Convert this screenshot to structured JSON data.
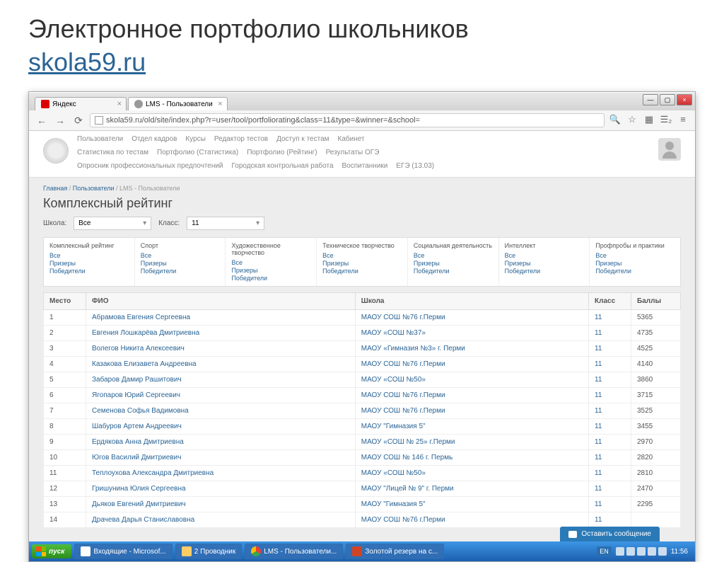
{
  "slide": {
    "title": "Электронное портфолио школьников",
    "link": "skola59.ru"
  },
  "browser": {
    "tabs": [
      {
        "title": "Яндекс"
      },
      {
        "title": "LMS - Пользователи"
      }
    ],
    "url": "skola59.ru/old/site/index.php?r=user/tool/portfoliorating&class=11&type=&winner=&school="
  },
  "nav": {
    "row1": [
      "Пользователи",
      "Отдел кадров",
      "Курсы",
      "Редактор тестов",
      "Доступ к тестам",
      "Кабинет"
    ],
    "row2": [
      "Статистика по тестам",
      "Портфолио (Статистика)",
      "Портфолио (Рейтинг)",
      "Результаты ОГЭ"
    ],
    "row3": [
      "Опросник профессиональных предпочтений",
      "Городская контрольная работа",
      "Воспитанники",
      "ЕГЭ (13.03)"
    ]
  },
  "breadcrumb": {
    "home": "Главная",
    "users": "Пользователи",
    "current": "LMS - Пользователи"
  },
  "pageTitle": "Комплексный рейтинг",
  "filters": {
    "schoolLabel": "Школа:",
    "schoolValue": "Все",
    "classLabel": "Класс:",
    "classValue": "11"
  },
  "categories": [
    "Комплексный рейтинг",
    "Спорт",
    "Художественное творчество",
    "Техническое творчество",
    "Социальная деятельность",
    "Интеллект",
    "Профпробы и практики"
  ],
  "catLinks": [
    "Все",
    "Призеры",
    "Победители"
  ],
  "tableHeaders": {
    "place": "Место",
    "name": "ФИО",
    "school": "Школа",
    "class": "Класс",
    "points": "Баллы"
  },
  "rows": [
    {
      "n": "1",
      "name": "Абрамова Евгения Сергеевна",
      "school": "МАОУ СОШ №76 г.Перми",
      "cls": "11",
      "pts": "5365"
    },
    {
      "n": "2",
      "name": "Евгения Лошкарёва Дмитриевна",
      "school": "МАОУ «СОШ №37»",
      "cls": "11",
      "pts": "4735"
    },
    {
      "n": "3",
      "name": "Волегов Никита Алексеевич",
      "school": "МАОУ «Гимназия №3» г. Перми",
      "cls": "11",
      "pts": "4525"
    },
    {
      "n": "4",
      "name": "Казакова Елизавета Андреевна",
      "school": "МАОУ СОШ №76 г.Перми",
      "cls": "11",
      "pts": "4140"
    },
    {
      "n": "5",
      "name": "Забаров Дамир Рашитович",
      "school": "МАОУ «СОШ №50»",
      "cls": "11",
      "pts": "3860"
    },
    {
      "n": "6",
      "name": "Ягопаров Юрий Сергеевич",
      "school": "МАОУ СОШ №76 г.Перми",
      "cls": "11",
      "pts": "3715"
    },
    {
      "n": "7",
      "name": "Семенова Софья Вадимовна",
      "school": "МАОУ СОШ №76 г.Перми",
      "cls": "11",
      "pts": "3525"
    },
    {
      "n": "8",
      "name": "Шабуров Артем Андреевич",
      "school": "МАОУ \"Гимназия 5\"",
      "cls": "11",
      "pts": "3455"
    },
    {
      "n": "9",
      "name": "Ердякова Анна Дмитриевна",
      "school": "МАОУ «СОШ № 25» г.Перми",
      "cls": "11",
      "pts": "2970"
    },
    {
      "n": "10",
      "name": "Югов Василий Дмитриевич",
      "school": "МАОУ СОШ № 146 г. Пермь",
      "cls": "11",
      "pts": "2820"
    },
    {
      "n": "11",
      "name": "Теплоухова Александра Дмитриевна",
      "school": "МАОУ «СОШ №50»",
      "cls": "11",
      "pts": "2810"
    },
    {
      "n": "12",
      "name": "Гришунина Юлия Сергеевна",
      "school": "МАОУ \"Лицей № 9\" г. Перми",
      "cls": "11",
      "pts": "2470"
    },
    {
      "n": "13",
      "name": "Дьяков Евгений Дмитриевич",
      "school": "МАОУ \"Гимназия 5\"",
      "cls": "11",
      "pts": "2295"
    },
    {
      "n": "14",
      "name": "Драчева Дарья Станиславовна",
      "school": "МАОУ СОШ №76 г.Перми",
      "cls": "11",
      "pts": ""
    }
  ],
  "chat": "Оставить сообщение",
  "taskbar": {
    "start": "пуск",
    "items": [
      "Входящие - Microsof...",
      "2 Проводник",
      "LMS - Пользователи...",
      "Золотой резерв на с..."
    ],
    "lang": "EN",
    "time": "11:56"
  }
}
